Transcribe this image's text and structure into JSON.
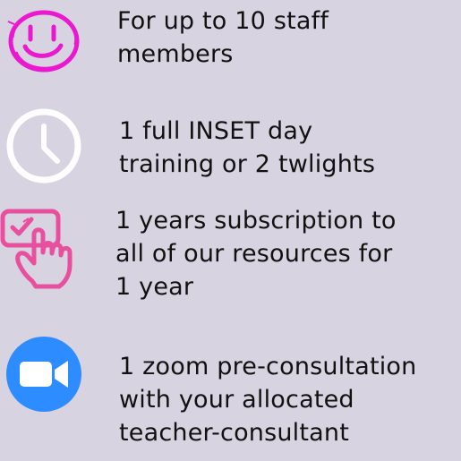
{
  "features": [
    {
      "icon": "smiley-face-icon",
      "lines": [
        "For up to 10 staff",
        "members"
      ]
    },
    {
      "icon": "clock-icon",
      "lines": [
        "1 full INSET day",
        "training or 2 twlights"
      ]
    },
    {
      "icon": "hand-pointing-checkbox-icon",
      "lines": [
        "1 years subscription to",
        "all of our resources for",
        "1 year"
      ]
    },
    {
      "icon": "zoom-video-camera-icon",
      "lines": [
        "1 zoom pre-consultation",
        "with your allocated",
        "teacher-consultant"
      ]
    }
  ],
  "colors": {
    "background": "#d8d3e0",
    "text": "#111111",
    "magenta": "#ea18cf",
    "pink": "#e8509f",
    "white": "#ffffff",
    "zoom_blue": "#2d8cff"
  }
}
